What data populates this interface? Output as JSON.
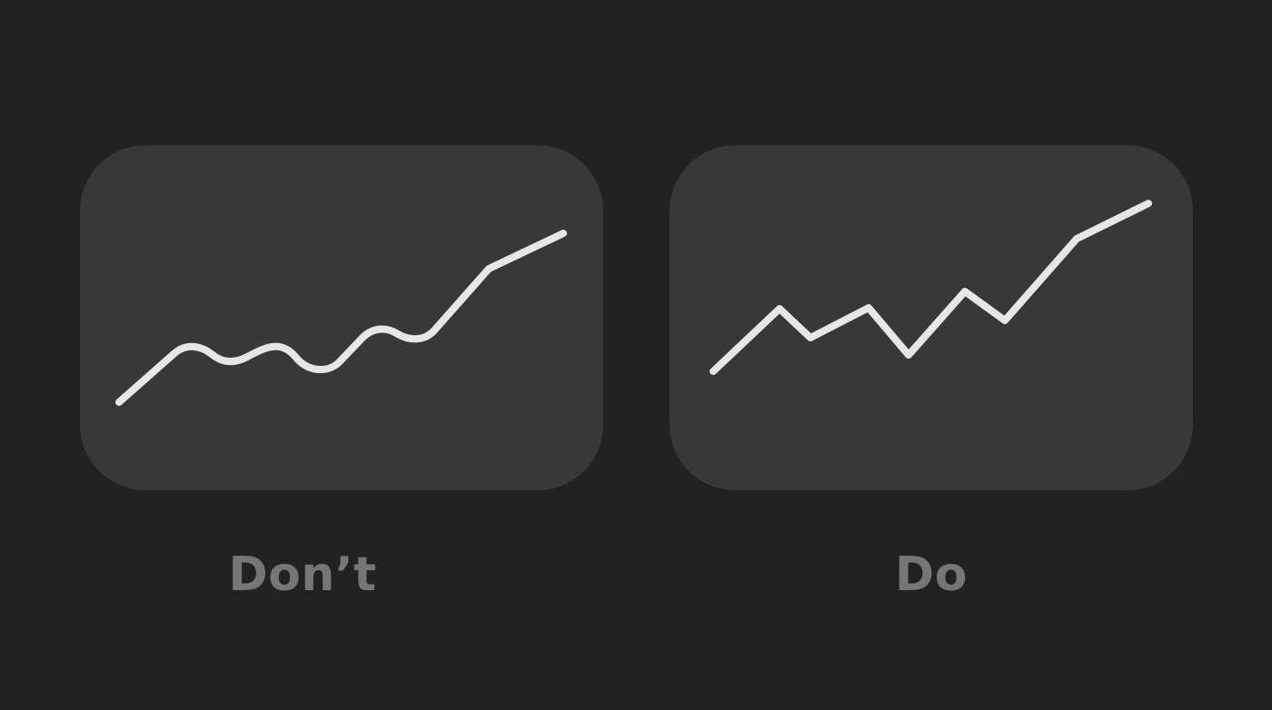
{
  "examples": {
    "dont": {
      "label": "Don’t",
      "line_style": "smooth-curve",
      "panel_color": "#383838",
      "line_color": "#e6e6e6"
    },
    "do": {
      "label": "Do",
      "line_style": "straight-segments",
      "panel_color": "#383838",
      "line_color": "#e6e6e6"
    }
  },
  "colors": {
    "background": "#222222",
    "caption": "#767676"
  }
}
